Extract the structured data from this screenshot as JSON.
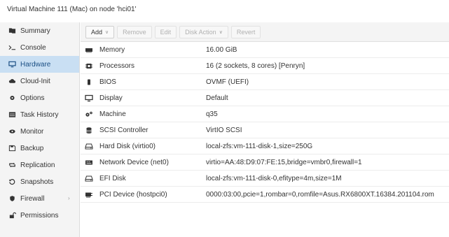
{
  "window": {
    "title": "Virtual Machine 111 (Mac) on node 'hci01'"
  },
  "sidebar": {
    "items": [
      {
        "label": "Summary",
        "icon": "book-icon",
        "active": false
      },
      {
        "label": "Console",
        "icon": "terminal-icon",
        "active": false
      },
      {
        "label": "Hardware",
        "icon": "desktop-icon",
        "active": true
      },
      {
        "label": "Cloud-Init",
        "icon": "cloud-icon",
        "active": false
      },
      {
        "label": "Options",
        "icon": "gear-icon",
        "active": false
      },
      {
        "label": "Task History",
        "icon": "list-icon",
        "active": false
      },
      {
        "label": "Monitor",
        "icon": "eye-icon",
        "active": false
      },
      {
        "label": "Backup",
        "icon": "floppy-icon",
        "active": false
      },
      {
        "label": "Replication",
        "icon": "retweet-icon",
        "active": false
      },
      {
        "label": "Snapshots",
        "icon": "history-icon",
        "active": false
      },
      {
        "label": "Firewall",
        "icon": "shield-icon",
        "active": false,
        "caret": "›"
      },
      {
        "label": "Permissions",
        "icon": "unlock-icon",
        "active": false
      }
    ]
  },
  "toolbar": {
    "add": "Add",
    "remove": "Remove",
    "edit": "Edit",
    "disk_action": "Disk Action",
    "revert": "Revert",
    "dropdown_caret": "∨"
  },
  "hardware": {
    "rows": [
      {
        "icon": "memory-icon",
        "key": "Memory",
        "value": "16.00 GiB"
      },
      {
        "icon": "cpu-icon",
        "key": "Processors",
        "value": "16 (2 sockets, 8 cores) [Penryn]"
      },
      {
        "icon": "bios-chip-icon",
        "key": "BIOS",
        "value": "OVMF (UEFI)"
      },
      {
        "icon": "monitor-icon",
        "key": "Display",
        "value": "Default"
      },
      {
        "icon": "cogs-icon",
        "key": "Machine",
        "value": "q35"
      },
      {
        "icon": "database-icon",
        "key": "SCSI Controller",
        "value": "VirtIO SCSI"
      },
      {
        "icon": "hard-disk-icon",
        "key": "Hard Disk (virtio0)",
        "value": "local-zfs:vm-111-disk-1,size=250G"
      },
      {
        "icon": "network-card-icon",
        "key": "Network Device (net0)",
        "value": "virtio=AA:48:D9:07:FE:15,bridge=vmbr0,firewall=1"
      },
      {
        "icon": "hard-disk-icon",
        "key": "EFI Disk",
        "value": "local-zfs:vm-111-disk-0,efitype=4m,size=1M"
      },
      {
        "icon": "pci-card-icon",
        "key": "PCI Device (hostpci0)",
        "value": "0000:03:00,pcie=1,rombar=0,romfile=Asus.RX6800XT.16384.201104.rom"
      }
    ]
  }
}
